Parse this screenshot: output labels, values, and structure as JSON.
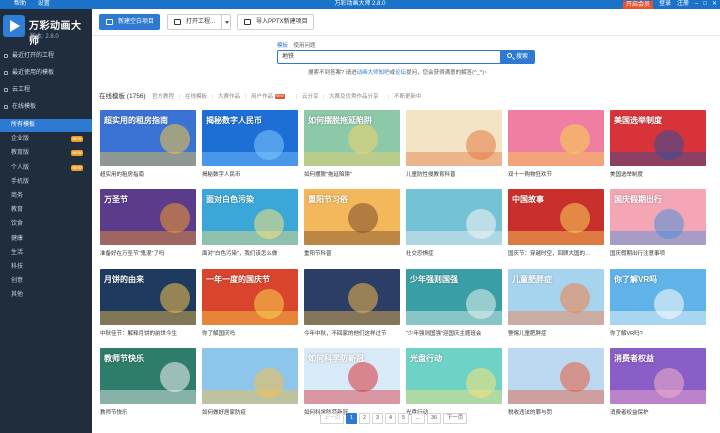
{
  "titlebar": {
    "menu": [
      "帮助",
      "设置"
    ],
    "title": "万彩动画大师 2.8.0",
    "vip_label": "开启会员",
    "login": "登录",
    "register": "注册",
    "window_controls": [
      "minimize-icon",
      "maximize-icon",
      "close-icon"
    ]
  },
  "brand": {
    "name": "万彩动画大师",
    "version": "版本: 2.8.0"
  },
  "sidebar": {
    "nav": [
      {
        "label": "最近打开的工程",
        "icon": "clock-icon"
      },
      {
        "label": "最近使用的模板",
        "icon": "template-icon"
      },
      {
        "label": "云工程",
        "icon": "cloud-icon"
      },
      {
        "label": "在线模板",
        "icon": "folder-icon"
      }
    ],
    "sub": [
      {
        "label": "所有模板",
        "badge": ""
      },
      {
        "label": "企业版",
        "badge": "NEW"
      },
      {
        "label": "教育版",
        "badge": "NEW"
      },
      {
        "label": "个人版",
        "badge": "NEW"
      },
      {
        "label": "手机版",
        "badge": ""
      },
      {
        "label": "商务",
        "badge": ""
      },
      {
        "label": "教育",
        "badge": ""
      },
      {
        "label": "饮食",
        "badge": ""
      },
      {
        "label": "健康",
        "badge": ""
      },
      {
        "label": "生活",
        "badge": ""
      },
      {
        "label": "科技",
        "badge": ""
      },
      {
        "label": "创意",
        "badge": ""
      },
      {
        "label": "其他",
        "badge": ""
      }
    ],
    "accent": "#2e79d1",
    "bg": "#1f2d3d"
  },
  "toolbar": {
    "new_project": "新建空白项目",
    "open_project": "打开工程...",
    "import_ppt": "导入PPTX新建项目"
  },
  "search": {
    "tabs": [
      "模板",
      "使用问题"
    ],
    "query": "地铁",
    "button": "搜索",
    "hint_prefix": "搜索不到答案? 请进",
    "hint_link1": "动画大师知吧",
    "hint_mid": "或",
    "hint_link2": "论坛",
    "hint_suffix": "提问，您会获得满意的解答(^_^)~"
  },
  "categories": {
    "heading": "在线模板 (1756)",
    "items": [
      "官方教程",
      "在线模板",
      "大赛作品",
      "用户作品",
      "云分享",
      "大赛及优秀作品分享",
      "不断更新中"
    ]
  },
  "templates": [
    {
      "caption": "超实用的租房指南",
      "title": "超实用的租房指南",
      "bg": "#3a73d4",
      "acc": "#f4c542"
    },
    {
      "caption": "揭秘数字人民币",
      "title": "揭秘数字人民币",
      "bg": "#1d6fd6",
      "acc": "#7ec8ff"
    },
    {
      "caption": "如何摆脱\"拖延陷阱\"",
      "title": "如何摆脱拖延陷阱",
      "bg": "#8bc9a8",
      "acc": "#f3d16a"
    },
    {
      "caption": "儿童防性侵教育科普",
      "title": "",
      "bg": "#f2e4c4",
      "acc": "#e57a45"
    },
    {
      "caption": "双十一购物狂欢节",
      "title": "",
      "bg": "#f07ea2",
      "acc": "#f7d34a"
    },
    {
      "caption": "美国选举制度",
      "title": "美国选举制度",
      "bg": "#d9333a",
      "acc": "#2f4f9a"
    },
    {
      "caption": "准备好在万圣节\"鬼混\"了吗",
      "title": "万圣节",
      "bg": "#5b3b8c",
      "acc": "#f19a2b"
    },
    {
      "caption": "面对\"白色污染\"，我们该怎么做",
      "title": "面对白色污染",
      "bg": "#3aa7d8",
      "acc": "#f6e27a"
    },
    {
      "caption": "重阳节科普",
      "title": "重阳节习俗",
      "bg": "#f2b85b",
      "acc": "#7a4b2a"
    },
    {
      "caption": "社交恐惧症",
      "title": "",
      "bg": "#73c2d6",
      "acc": "#f5f5f5"
    },
    {
      "caption": "国庆节：穿越时空，回顾大国的…",
      "title": "中国故事",
      "bg": "#c9302c",
      "acc": "#f7d45c"
    },
    {
      "caption": "国庆假期出行注意事项",
      "title": "国庆假期出行",
      "bg": "#f4a6b4",
      "acc": "#4a90d9"
    },
    {
      "caption": "中秋佳节：解释月饼的前世今生",
      "title": "月饼的由来",
      "bg": "#1f3a5f",
      "acc": "#f6c34b"
    },
    {
      "caption": "你了解国庆吗",
      "title": "一年一度的国庆节",
      "bg": "#d9442d",
      "acc": "#f7d44c"
    },
    {
      "caption": "今年中秋，不回家的他们这样过节",
      "title": "",
      "bg": "#2c3e66",
      "acc": "#f2b84b"
    },
    {
      "caption": "\"少年强则国强\"迎国庆主题班会",
      "title": "少年强则国强",
      "bg": "#3a9ea5",
      "acc": "#e6f4f2"
    },
    {
      "caption": "警惕儿童肥胖症",
      "title": "儿童肥胖症",
      "bg": "#a6d4ef",
      "acc": "#f37f46"
    },
    {
      "caption": "你了解VR吗?",
      "title": "你了解VR吗",
      "bg": "#5fb3e8",
      "acc": "#ffffff"
    },
    {
      "caption": "教师节快乐",
      "title": "教师节快乐",
      "bg": "#2e7d6b",
      "acc": "#f5f5f5"
    },
    {
      "caption": "如何做好居家防疫",
      "title": "",
      "bg": "#8ec5ea",
      "acc": "#f6c04a"
    },
    {
      "caption": "如何科学防范新冠",
      "title": "如何科学防新冠",
      "bg": "#d8e9f7",
      "acc": "#d9333a"
    },
    {
      "caption": "光盘行动",
      "title": "光盘行动",
      "bg": "#6fd2c6",
      "acc": "#f6e27a"
    },
    {
      "caption": "税收违法的罪与罚",
      "title": "",
      "bg": "#bcd8f0",
      "acc": "#e25b3b"
    },
    {
      "caption": "消费者权益保护",
      "title": "消费者权益",
      "bg": "#8a5ec7",
      "acc": "#f3b0c9"
    }
  ],
  "pager": {
    "prev": "上一页",
    "pages": [
      "1",
      "2",
      "3",
      "4",
      "5",
      "...",
      "36"
    ],
    "current": "1",
    "next": "下一页"
  }
}
